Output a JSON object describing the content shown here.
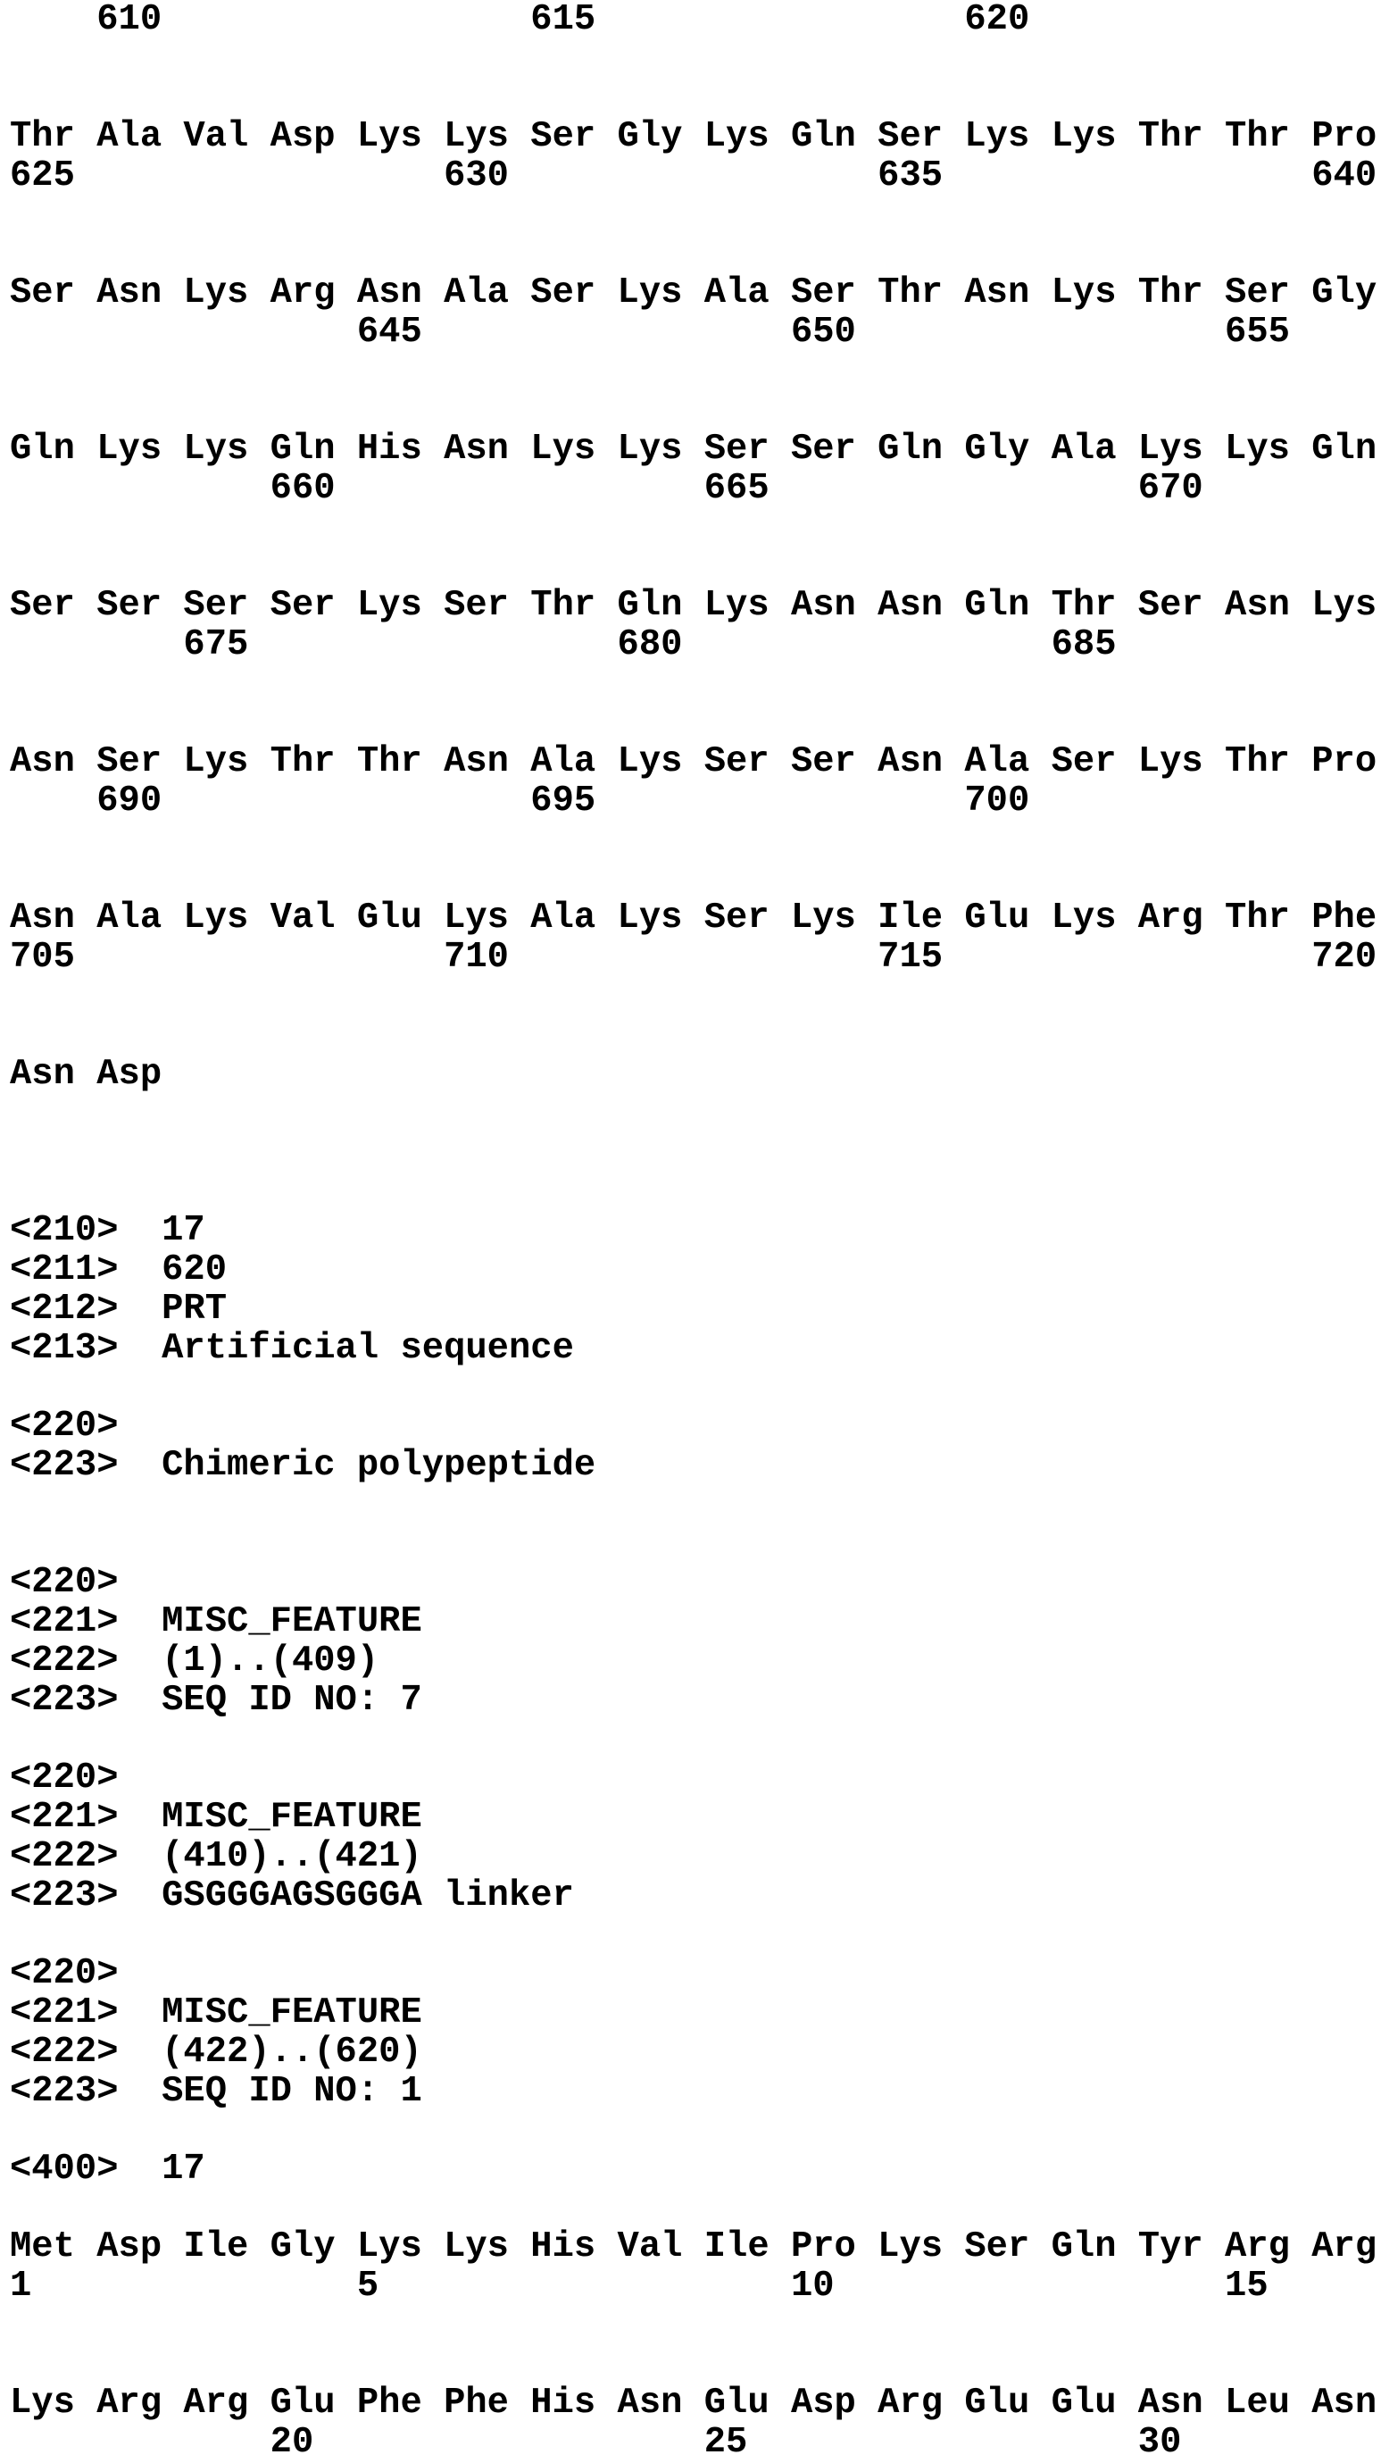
{
  "lines": [
    "    610                 615                 620",
    "Thr Ala Val Asp Lys Lys Ser Gly Lys Gln Ser Lys Lys Thr Thr Pro",
    "625                 630                 635                 640",
    "Ser Asn Lys Arg Asn Ala Ser Lys Ala Ser Thr Asn Lys Thr Ser Gly",
    "                645                 650                 655",
    "Gln Lys Lys Gln His Asn Lys Lys Ser Ser Gln Gly Ala Lys Lys Gln",
    "            660                 665                 670",
    "Ser Ser Ser Ser Lys Ser Thr Gln Lys Asn Asn Gln Thr Ser Asn Lys",
    "        675                 680                 685",
    "Asn Ser Lys Thr Thr Asn Ala Lys Ser Ser Asn Ala Ser Lys Thr Pro",
    "    690                 695                 700",
    "Asn Ala Lys Val Glu Lys Ala Lys Ser Lys Ile Glu Lys Arg Thr Phe",
    "705                 710                 715                 720",
    "Asn Asp",
    "<210>  17",
    "<211>  620",
    "<212>  PRT",
    "<213>  Artificial sequence",
    "<220>",
    "<223>  Chimeric polypeptide",
    "<220>",
    "<221>  MISC_FEATURE",
    "<222>  (1)..(409)",
    "<223>  SEQ ID NO: 7",
    "<220>",
    "<221>  MISC_FEATURE",
    "<222>  (410)..(421)",
    "<223>  GSGGGAGSGGGA linker",
    "<220>",
    "<221>  MISC_FEATURE",
    "<222>  (422)..(620)",
    "<223>  SEQ ID NO: 1",
    "<400>  17",
    "Met Asp Ile Gly Lys Lys His Val Ile Pro Lys Ser Gln Tyr Arg Arg",
    "1               5                   10                  15",
    "Lys Arg Arg Glu Phe Phe His Asn Glu Asp Arg Glu Glu Asn Leu Asn",
    "            20                  25                  30"
  ]
}
